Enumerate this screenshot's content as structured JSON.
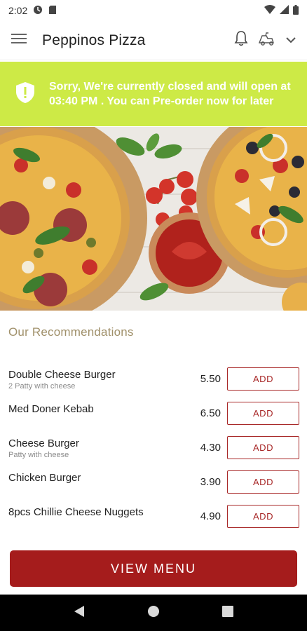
{
  "status_bar": {
    "time": "2:02",
    "icons": [
      "data-saver-icon",
      "sd-card-icon",
      "wifi-icon",
      "cell-signal-icon",
      "battery-icon"
    ]
  },
  "app_bar": {
    "title": "Peppinos Pizza",
    "icons": [
      "menu-icon",
      "bell-icon",
      "delivery-mode-icon",
      "chevron-down-icon"
    ]
  },
  "banner": {
    "message": "Sorry, We're currently closed and will open at 03:40 PM . You can Pre-order now for later",
    "color": "#cdea46",
    "icon": "shield-alert-icon"
  },
  "hero": {
    "image": "pizza-photo"
  },
  "recommendations": {
    "title": "Our Recommendations",
    "add_label": "ADD",
    "items": [
      {
        "name": "Double Cheese Burger",
        "desc": "2 Patty with cheese",
        "price": "5.50"
      },
      {
        "name": "Med Doner Kebab",
        "desc": "",
        "price": "6.50"
      },
      {
        "name": "Cheese Burger",
        "desc": "Patty with cheese",
        "price": "4.30"
      },
      {
        "name": "Chicken Burger",
        "desc": "",
        "price": "3.90"
      },
      {
        "name": "8pcs Chillie Cheese Nuggets",
        "desc": "",
        "price": "4.90"
      }
    ]
  },
  "view_menu": {
    "label": "VIEW MENU",
    "color": "#a51c1c"
  },
  "nav_bar": {
    "icons": [
      "back-icon",
      "home-icon",
      "recents-icon"
    ]
  }
}
